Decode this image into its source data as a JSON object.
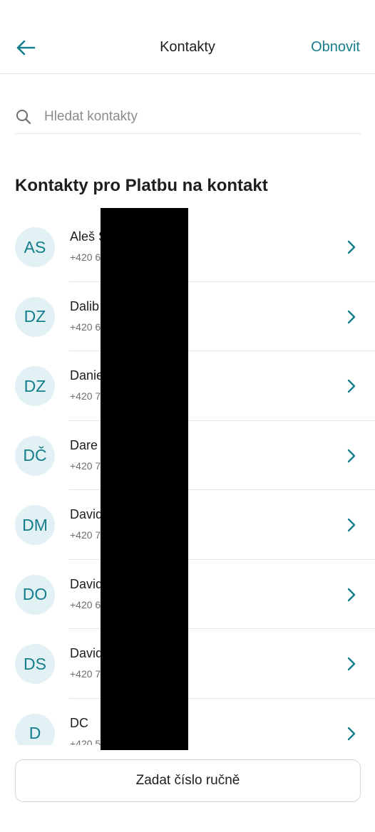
{
  "header": {
    "title": "Kontakty",
    "refresh_label": "Obnovit",
    "back_icon": "arrow-left-icon"
  },
  "search": {
    "placeholder": "Hledat kontakty",
    "value": "",
    "icon": "search-icon"
  },
  "section_title": "Kontakty pro Platbu na kontakt",
  "contacts": [
    {
      "initials": "AS",
      "name": "Aleš S",
      "phone": "+420 6"
    },
    {
      "initials": "DZ",
      "name": "Dalib",
      "phone": "+420 6"
    },
    {
      "initials": "DZ",
      "name": "Danie",
      "phone": "+420 7"
    },
    {
      "initials": "DČ",
      "name": "Dare",
      "phone": "+420 7"
    },
    {
      "initials": "DM",
      "name": "David",
      "phone": "+420 7"
    },
    {
      "initials": "DO",
      "name": "David",
      "phone": "+420 6"
    },
    {
      "initials": "DS",
      "name": "David",
      "phone": "+420 7"
    },
    {
      "initials": "D",
      "name": "DC",
      "phone": "+420 5"
    }
  ],
  "manual_button_label": "Zadat číslo ručně",
  "colors": {
    "accent": "#147e8c",
    "avatar_bg": "#e2f1f4",
    "divider": "#e4e6e6",
    "redaction": "#000000"
  }
}
